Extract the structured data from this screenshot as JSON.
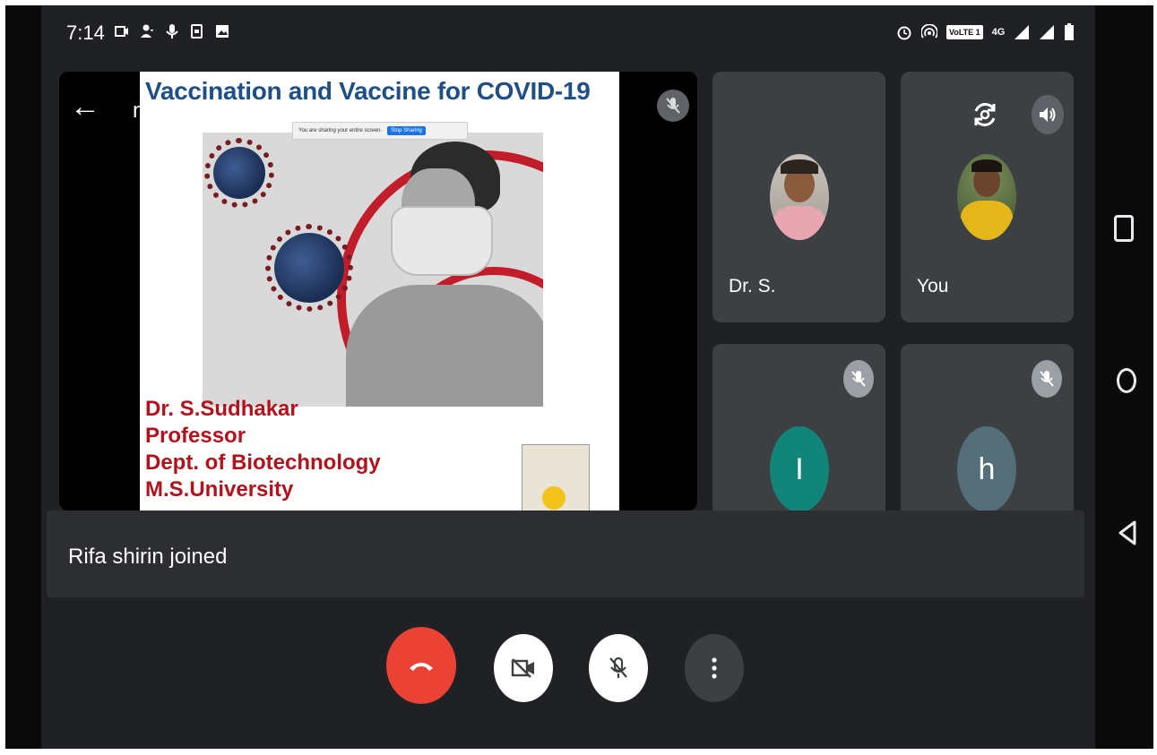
{
  "status_bar": {
    "time": "7:14",
    "left_icons": [
      "screen-record-icon",
      "person-add-icon",
      "mic-icon",
      "sim-icon",
      "image-icon"
    ],
    "right_icons": [
      "alarm-icon",
      "hotspot-icon",
      "volte-badge",
      "4g-signal-icon",
      "signal-icon",
      "battery-icon"
    ],
    "volte_text": "VoLTE 1",
    "network_text": "4G"
  },
  "meeting": {
    "code": "nyc-hbvh-xvh"
  },
  "presentation": {
    "slide_title": "Vaccination and Vaccine for COVID-19",
    "presenter_lines": [
      "Dr. S.Sudhakar",
      "Professor",
      "Dept. of Biotechnology",
      "M.S.University"
    ],
    "share_banner_text": "You are sharing your entire screen.",
    "share_stop_label": "Stop Sharing"
  },
  "participants": [
    {
      "name": "Dr. S.",
      "avatar": "photo",
      "muted": false
    },
    {
      "name": "You",
      "avatar": "photo",
      "muted": false
    },
    {
      "name": "",
      "avatar": "letter",
      "letter": "I",
      "color": "#12857a",
      "muted": true
    },
    {
      "name": "",
      "avatar": "letter",
      "letter": "h",
      "color": "#546e7a",
      "muted": true
    }
  ],
  "toast": {
    "message": "Rifa shirin joined"
  },
  "controls": {
    "end_call": "end-call-icon",
    "camera": "camera-off-icon",
    "microphone": "mic-off-icon",
    "more": "more-options-icon",
    "end_color": "#ea4335"
  },
  "colors": {
    "app_background": "#202124",
    "tile_background": "#3c4043",
    "slide_title": "#1f4f86",
    "slide_text": "#b3121d"
  }
}
